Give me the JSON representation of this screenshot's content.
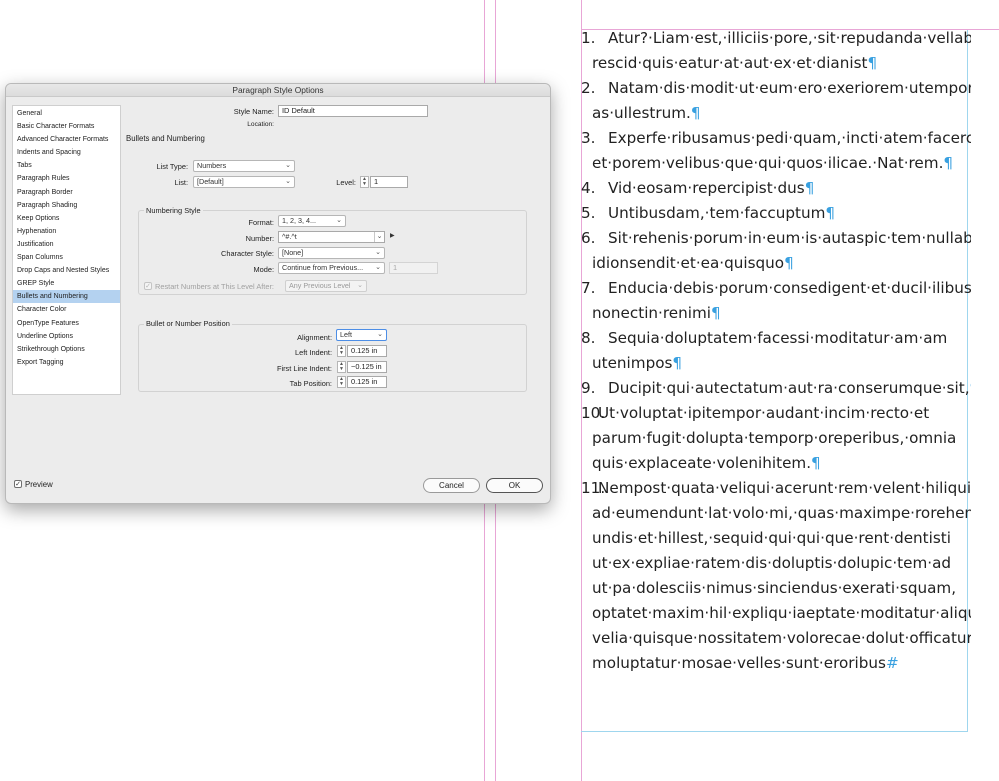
{
  "dialog": {
    "title": "Paragraph Style Options",
    "sidebar": [
      "General",
      "Basic Character Formats",
      "Advanced Character Formats",
      "Indents and Spacing",
      "Tabs",
      "Paragraph Rules",
      "Paragraph Border",
      "Paragraph Shading",
      "Keep Options",
      "Hyphenation",
      "Justification",
      "Span Columns",
      "Drop Caps and Nested Styles",
      "GREP Style",
      "Bullets and Numbering",
      "Character Color",
      "OpenType Features",
      "Underline Options",
      "Strikethrough Options",
      "Export Tagging"
    ],
    "selected_index": 14,
    "style_name_label": "Style Name:",
    "style_name_value": "ID Default",
    "location_label": "Location:",
    "section_title": "Bullets and Numbering",
    "list_type_label": "List Type:",
    "list_type_value": "Numbers",
    "list_label": "List:",
    "list_value": "[Default]",
    "level_label": "Level:",
    "level_value": "1",
    "numbering_style": {
      "title": "Numbering Style",
      "format_label": "Format:",
      "format_value": "1, 2, 3, 4...",
      "number_label": "Number:",
      "number_value": "^#.^t",
      "char_style_label": "Character Style:",
      "char_style_value": "[None]",
      "mode_label": "Mode:",
      "mode_value": "Continue from Previous...",
      "mode_number": "1",
      "restart_label": "Restart Numbers at This Level After:",
      "restart_value": "Any Previous Level"
    },
    "position": {
      "title": "Bullet or Number Position",
      "alignment_label": "Alignment:",
      "alignment_value": "Left",
      "left_indent_label": "Left Indent:",
      "left_indent_value": "0.125 in",
      "first_line_label": "First Line Indent:",
      "first_line_value": "−0.125 in",
      "tab_position_label": "Tab Position:",
      "tab_position_value": "0.125 in"
    },
    "preview_label": "Preview",
    "cancel_label": "Cancel",
    "ok_label": "OK"
  },
  "document": {
    "paragraphs": [
      {
        "num": "1.",
        "lines": [
          "Atur?·Liam·est,·illiciis·pore,·sit·repudanda·vellabo",
          "rescid·quis·eatur·at·aut·ex·et·dianist"
        ],
        "end": "¶"
      },
      {
        "num": "2.",
        "lines": [
          "Natam·dis·modit·ut·eum·ero·exeriorem·utempor",
          "as·ullestrum."
        ],
        "end": "¶"
      },
      {
        "num": "3.",
        "lines": [
          "Experfe·ribusamus·pedi·quam,·incti·atem·facero",
          "et·porem·velibus·que·qui·quos·ilicae.·Nat·rem."
        ],
        "end": "¶"
      },
      {
        "num": "4.",
        "lines": [
          "Vid·eosam·repercipist·dus"
        ],
        "end": "¶"
      },
      {
        "num": "5.",
        "lines": [
          "Untibusdam,·tem·faccuptum"
        ],
        "end": "¶"
      },
      {
        "num": "6.",
        "lines": [
          "Sit·rehenis·porum·in·eum·is·autaspic·tem·nullab",
          "idionsendit·et·ea·quisquo"
        ],
        "end": "¶"
      },
      {
        "num": "7.",
        "lines": [
          "Enducia·debis·porum·consedigent·et·ducil·ilibusam",
          "nonectin·renimi"
        ],
        "end": "¶"
      },
      {
        "num": "8.",
        "lines": [
          "Sequia·doluptatem·facessi·moditatur·am·am",
          "utenimpos"
        ],
        "end": "¶"
      },
      {
        "num": "9.",
        "lines": [
          "Ducipit·qui·autectatum·aut·ra·conserumque·sit,"
        ],
        "end": "¶"
      },
      {
        "num": "10.",
        "lines": [
          "Ut·voluptat·ipitempor·audant·incim·recto·et",
          "parum·fugit·dolupta·temporp·oreperibus,·omnia",
          "quis·explaceate·volenihitem."
        ],
        "end": "¶"
      },
      {
        "num": "11.",
        "lines": [
          "Nempost·quata·veliqui·acerunt·rem·velent·hiliqui",
          "ad·eumendunt·lat·volo·mi,·quas·maximpe·rorehenis",
          "undis·et·hillest,·sequid·qui·qui·que·rent·dentisti",
          "ut·ex·expliae·ratem·dis·doluptis·dolupic·tem·ad",
          "ut·pa·dolesciis·nimus·sinciendus·exerati·squam,",
          "optatet·maxim·hil·expliqu·iaeptate·moditatur·alique",
          "velia·quisque·nossitatem·volorecae·dolut·officatur",
          "moluptatur·mosae·velles·sunt·eroribus"
        ],
        "end": "#"
      }
    ]
  }
}
